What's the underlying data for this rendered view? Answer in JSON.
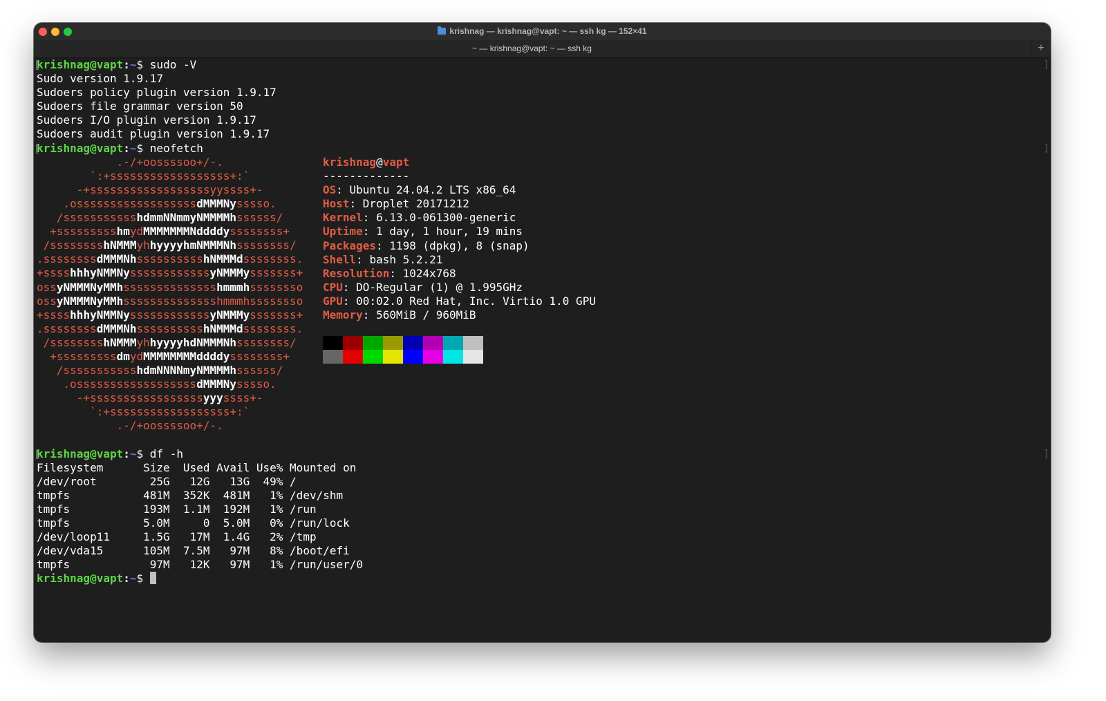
{
  "window": {
    "title": "krishnag — krishnag@vapt: ~ — ssh kg — 152×41",
    "tab_label": "~ — krishnag@vapt: ~ — ssh kg",
    "new_tab_label": "+"
  },
  "prompt": {
    "user_host": "krishnag@vapt",
    "sep": ":",
    "path": "~",
    "symbol": "$"
  },
  "session": {
    "cmd1": "sudo -V",
    "sudo_out": [
      "Sudo version 1.9.17",
      "Sudoers policy plugin version 1.9.17",
      "Sudoers file grammar version 50",
      "Sudoers I/O plugin version 1.9.17",
      "Sudoers audit plugin version 1.9.17"
    ],
    "cmd2": "neofetch",
    "ascii": [
      [
        [
          "r",
          "            .-/+oossssoo+/-."
        ]
      ],
      [
        [
          "r",
          "        `:+ssssssssssssssssss+:`"
        ]
      ],
      [
        [
          "r",
          "      -+ssssssssssssssssssyyssss+-"
        ]
      ],
      [
        [
          "r",
          "    .ossssssssssssssssss"
        ],
        [
          "w",
          "dMMMNy"
        ],
        [
          "r",
          "sssso."
        ]
      ],
      [
        [
          "r",
          "   /sssssssssss"
        ],
        [
          "w",
          "hdmmNNmmyNMMMMh"
        ],
        [
          "r",
          "ssssss/"
        ]
      ],
      [
        [
          "r",
          "  +sssssssss"
        ],
        [
          "w",
          "hm"
        ],
        [
          "r",
          "yd"
        ],
        [
          "w",
          "MMMMMMMNddddy"
        ],
        [
          "r",
          "ssssssss+"
        ]
      ],
      [
        [
          "r",
          " /ssssssss"
        ],
        [
          "w",
          "hNMMM"
        ],
        [
          "r",
          "yh"
        ],
        [
          "w",
          "hyyyyhmNMMMNh"
        ],
        [
          "r",
          "ssssssss/"
        ]
      ],
      [
        [
          "r",
          ".ssssssss"
        ],
        [
          "w",
          "dMMMNh"
        ],
        [
          "r",
          "ssssssssss"
        ],
        [
          "w",
          "hNMMMd"
        ],
        [
          "r",
          "ssssssss."
        ]
      ],
      [
        [
          "r",
          "+ssss"
        ],
        [
          "w",
          "hhhyNMMNy"
        ],
        [
          "r",
          "ssssssssssss"
        ],
        [
          "w",
          "yNMMMy"
        ],
        [
          "r",
          "sssssss+"
        ]
      ],
      [
        [
          "r",
          "oss"
        ],
        [
          "w",
          "yNMMMNyMMh"
        ],
        [
          "r",
          "ssssssssssssss"
        ],
        [
          "w",
          "hmmmh"
        ],
        [
          "r",
          "ssssssso"
        ]
      ],
      [
        [
          "r",
          "oss"
        ],
        [
          "w",
          "yNMMMNyMMh"
        ],
        [
          "r",
          "sssssssssssssshmmmhssssssso"
        ]
      ],
      [
        [
          "r",
          "+ssss"
        ],
        [
          "w",
          "hhhyNMMNy"
        ],
        [
          "r",
          "ssssssssssss"
        ],
        [
          "w",
          "yNMMMy"
        ],
        [
          "r",
          "sssssss+"
        ]
      ],
      [
        [
          "r",
          ".ssssssss"
        ],
        [
          "w",
          "dMMMNh"
        ],
        [
          "r",
          "ssssssssss"
        ],
        [
          "w",
          "hNMMMd"
        ],
        [
          "r",
          "ssssssss."
        ]
      ],
      [
        [
          "r",
          " /ssssssss"
        ],
        [
          "w",
          "hNMMM"
        ],
        [
          "r",
          "yh"
        ],
        [
          "w",
          "hyyyyhdNMMMNh"
        ],
        [
          "r",
          "ssssssss/"
        ]
      ],
      [
        [
          "r",
          "  +sssssssss"
        ],
        [
          "w",
          "dm"
        ],
        [
          "r",
          "yd"
        ],
        [
          "w",
          "MMMMMMMMddddy"
        ],
        [
          "r",
          "ssssssss+"
        ]
      ],
      [
        [
          "r",
          "   /sssssssssss"
        ],
        [
          "w",
          "hdmNNNNmyNMMMMh"
        ],
        [
          "r",
          "ssssss/"
        ]
      ],
      [
        [
          "r",
          "    .ossssssssssssssssss"
        ],
        [
          "w",
          "dMMMNy"
        ],
        [
          "r",
          "sssso."
        ]
      ],
      [
        [
          "r",
          "      -+sssssssssssssssss"
        ],
        [
          "w",
          "yyy"
        ],
        [
          "r",
          "ssss+-"
        ]
      ],
      [
        [
          "r",
          "        `:+ssssssssssssssssss+:`"
        ]
      ],
      [
        [
          "r",
          "            .-/+oossssoo+/-."
        ]
      ]
    ],
    "info_title": {
      "user": "krishnag",
      "at": "@",
      "host": "vapt"
    },
    "info_sep": "-------------",
    "info": [
      {
        "k": "OS",
        "v": "Ubuntu 24.04.2 LTS x86_64"
      },
      {
        "k": "Host",
        "v": "Droplet 20171212"
      },
      {
        "k": "Kernel",
        "v": "6.13.0-061300-generic"
      },
      {
        "k": "Uptime",
        "v": "1 day, 1 hour, 19 mins"
      },
      {
        "k": "Packages",
        "v": "1198 (dpkg), 8 (snap)"
      },
      {
        "k": "Shell",
        "v": "bash 5.2.21"
      },
      {
        "k": "Resolution",
        "v": "1024x768"
      },
      {
        "k": "CPU",
        "v": "DO-Regular (1) @ 1.995GHz"
      },
      {
        "k": "GPU",
        "v": "00:02.0 Red Hat, Inc. Virtio 1.0 GPU"
      },
      {
        "k": "Memory",
        "v": "560MiB / 960MiB"
      }
    ],
    "palette_colors": [
      "#000000",
      "#990000",
      "#00a600",
      "#999900",
      "#0000b2",
      "#b200b2",
      "#00a6b2",
      "#bfbfbf",
      "#666666",
      "#e50000",
      "#00d900",
      "#e5e500",
      "#0000ff",
      "#e500e5",
      "#00e5e5",
      "#e5e5e5"
    ],
    "cmd3": "df -h",
    "df_header": "Filesystem      Size  Used Avail Use% Mounted on",
    "df_rows": [
      "/dev/root        25G   12G   13G  49% /",
      "tmpfs           481M  352K  481M   1% /dev/shm",
      "tmpfs           193M  1.1M  192M   1% /run",
      "tmpfs           5.0M     0  5.0M   0% /run/lock",
      "/dev/loop11     1.5G   17M  1.4G   2% /tmp",
      "/dev/vda15      105M  7.5M   97M   8% /boot/efi",
      "tmpfs            97M   12K   97M   1% /run/user/0"
    ]
  },
  "colors": {
    "prompt_user": "#5ed548",
    "prompt_path": "#5a73f5",
    "accent_red": "#e25c45",
    "terminal_bg": "#1e1e1e"
  }
}
